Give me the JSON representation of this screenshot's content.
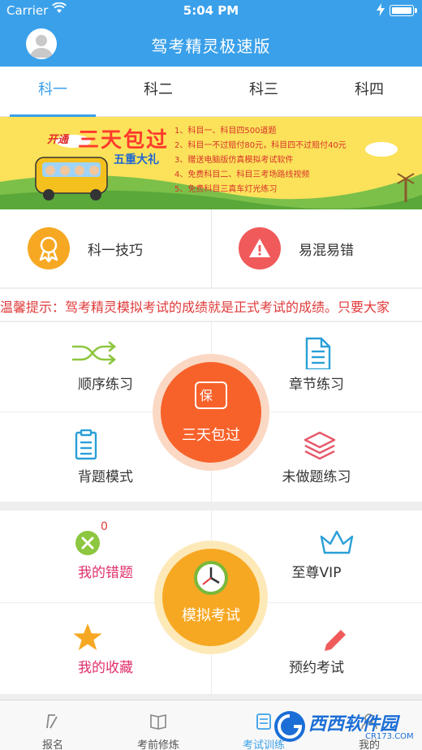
{
  "status": {
    "carrier": "Carrier",
    "time": "5:04 PM"
  },
  "nav": {
    "title": "驾考精灵极速版"
  },
  "tabs": [
    {
      "label": "科一",
      "active": true
    },
    {
      "label": "科二",
      "active": false
    },
    {
      "label": "科三",
      "active": false
    },
    {
      "label": "科四",
      "active": false
    }
  ],
  "banner": {
    "open": "开通",
    "headline": "三天包过",
    "gift": "五重大礼",
    "lines": [
      "1、科目一、科目四500道题",
      "2、科目一不过赔付80元，科目四不过赔付40元",
      "3、赠送电脑版仿真模拟考试软件",
      "4、免费科目二、科目三考场路线视频",
      "5、免费科目三真车灯光练习"
    ]
  },
  "quick": [
    {
      "label": "科一技巧",
      "icon": "medal-icon",
      "color": "#f7a823"
    },
    {
      "label": "易混易错",
      "icon": "warning-icon",
      "color": "#f05a5b"
    }
  ],
  "notice": {
    "text": "温馨提示：驾考精灵模拟考试的成绩就是正式考试的成绩。只要大家"
  },
  "practice": {
    "items": [
      {
        "label": "顺序练习",
        "icon": "shuffle-icon"
      },
      {
        "label": "章节练习",
        "icon": "document-icon"
      },
      {
        "label": "背题模式",
        "icon": "clipboard-icon"
      },
      {
        "label": "未做题练习",
        "icon": "layers-icon"
      }
    ],
    "center": {
      "label": "三天包过",
      "badge": "保"
    }
  },
  "exam": {
    "items": [
      {
        "label": "我的错题",
        "icon": "wrong-icon",
        "badge": "0"
      },
      {
        "label": "至尊VIP",
        "icon": "crown-icon"
      },
      {
        "label": "我的收藏",
        "icon": "star-icon"
      },
      {
        "label": "预约考试",
        "icon": "pencil-icon"
      }
    ],
    "center": {
      "label": "模拟考试"
    }
  },
  "tabbar": [
    {
      "label": "报名",
      "icon": "signup-icon",
      "active": false
    },
    {
      "label": "考前修炼",
      "icon": "book-icon",
      "active": false
    },
    {
      "label": "考试训练",
      "icon": "train-icon",
      "active": true
    },
    {
      "label": "我的",
      "icon": "user-icon",
      "active": false
    }
  ],
  "watermark": {
    "name": "西西软件园",
    "domain": "CR173.COM"
  },
  "colors": {
    "primary": "#3aa0ea",
    "accent_red": "#e03a3a",
    "orange": "#f7a823"
  }
}
